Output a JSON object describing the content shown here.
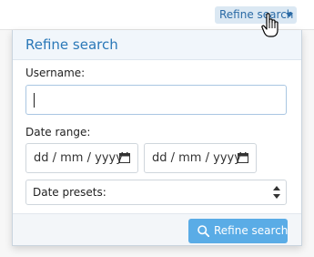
{
  "trigger": {
    "label": "Refine search",
    "icon": "caret-down-icon"
  },
  "menu": {
    "title": "Refine search",
    "username": {
      "label": "Username:",
      "value": "",
      "placeholder": ""
    },
    "date_range": {
      "label": "Date range:",
      "start": {
        "value": "dd / mm / yyyy",
        "icon": "calendar-icon"
      },
      "end": {
        "value": "dd / mm / yyyy",
        "icon": "calendar-icon"
      }
    },
    "date_presets": {
      "selected": "Date presets:",
      "icon": "select-arrows-icon"
    },
    "submit": {
      "label": "Refine search",
      "icon": "search-icon"
    }
  },
  "colors": {
    "accent": "#2a78b8",
    "button": "#5aace6",
    "trigger_bg": "#dbe8f3"
  }
}
